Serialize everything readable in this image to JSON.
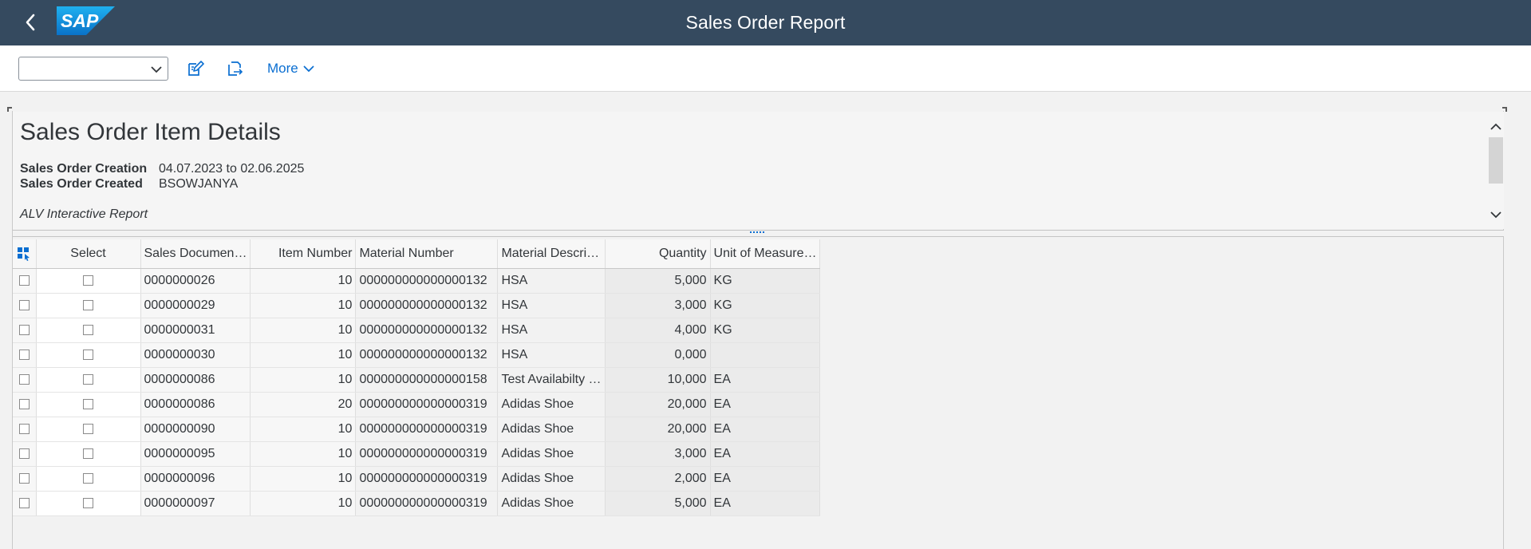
{
  "shell": {
    "title": "Sales Order Report",
    "logo_text": "SAP",
    "back_icon": "chevron-left-icon",
    "bg_color": "#354a5f"
  },
  "toolbar": {
    "variant_value": "",
    "more_label": "More",
    "accent_color": "#0a6ed1"
  },
  "report": {
    "title": "Sales Order Item Details",
    "criteria": [
      {
        "label": "Sales Order Creation",
        "value": "04.07.2023 to 02.06.2025"
      },
      {
        "label": "Sales Order Created",
        "value": "BSOWJANYA"
      }
    ],
    "note": "ALV Interactive Report"
  },
  "table": {
    "columns": [
      "Select",
      "Sales Documen…",
      "Item Number",
      "Material Number",
      "Material Descri…",
      "Quantity",
      "Unit of Measure…"
    ],
    "rows": [
      {
        "doc": "0000000026",
        "item": "10",
        "material": "000000000000000132",
        "desc": "HSA",
        "qty": "5,000",
        "uom": "KG"
      },
      {
        "doc": "0000000029",
        "item": "10",
        "material": "000000000000000132",
        "desc": "HSA",
        "qty": "3,000",
        "uom": "KG"
      },
      {
        "doc": "0000000031",
        "item": "10",
        "material": "000000000000000132",
        "desc": "HSA",
        "qty": "4,000",
        "uom": "KG"
      },
      {
        "doc": "0000000030",
        "item": "10",
        "material": "000000000000000132",
        "desc": "HSA",
        "qty": "0,000",
        "uom": ""
      },
      {
        "doc": "0000000086",
        "item": "10",
        "material": "000000000000000158",
        "desc": "Test Availabilty …",
        "qty": "10,000",
        "uom": "EA"
      },
      {
        "doc": "0000000086",
        "item": "20",
        "material": "000000000000000319",
        "desc": "Adidas Shoe",
        "qty": "20,000",
        "uom": "EA"
      },
      {
        "doc": "0000000090",
        "item": "10",
        "material": "000000000000000319",
        "desc": "Adidas Shoe",
        "qty": "20,000",
        "uom": "EA"
      },
      {
        "doc": "0000000095",
        "item": "10",
        "material": "000000000000000319",
        "desc": "Adidas Shoe",
        "qty": "3,000",
        "uom": "EA"
      },
      {
        "doc": "0000000096",
        "item": "10",
        "material": "000000000000000319",
        "desc": "Adidas Shoe",
        "qty": "2,000",
        "uom": "EA"
      },
      {
        "doc": "0000000097",
        "item": "10",
        "material": "000000000000000319",
        "desc": "Adidas Shoe",
        "qty": "5,000",
        "uom": "EA"
      }
    ]
  }
}
